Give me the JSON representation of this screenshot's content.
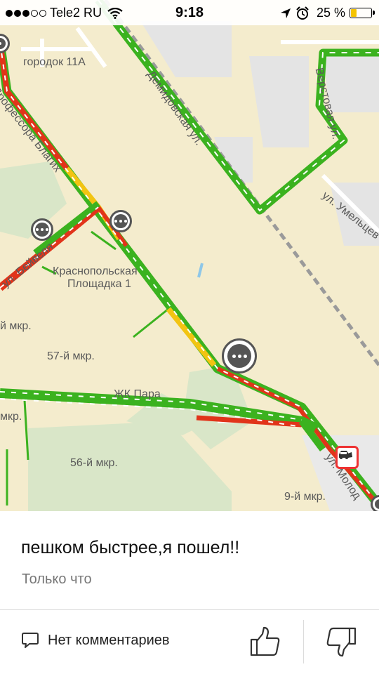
{
  "status_bar": {
    "carrier": "Tele2 RU",
    "time": "9:18",
    "battery_percent": "25 %",
    "battery_level": 0.25,
    "icons": [
      "signal-icon",
      "wifi-icon",
      "location-arrow-icon",
      "alarm-icon",
      "battery-icon"
    ]
  },
  "map": {
    "labels": {
      "gorodok": "городок 11А",
      "prof_blaгikh": "Профессора Благих",
      "demidovskaya": "Демидовская ул.",
      "verstovaya": "Верстовая ул.",
      "umeltsev": "ул. Умельцев",
      "beyvelya": "ул. Бейвеля",
      "krasnopolskaya_1": "Краснопольская",
      "krasnopolskaya_2": "Площадка 1",
      "mkr_57": "57-й мкр.",
      "zhk_para": "ЖК Пара",
      "mkr_56": "56-й мкр.",
      "mkr_9": "9-й мкр.",
      "mkr_left_1": "й мкр.",
      "mkr_left_2": "мкр.",
      "molod": "ул. Молод"
    },
    "colors": {
      "background": "#f4eccd",
      "park": "#d9e6c8",
      "block": "#e6e6e6",
      "traffic_green": "#3bb21f",
      "traffic_red": "#e1341a",
      "traffic_yellow": "#f2c412"
    }
  },
  "post": {
    "text": "пешком быстрее,я пошел!!",
    "time": "Только что"
  },
  "footer": {
    "comments_label": "Нет комментариев",
    "icons": [
      "comment-icon",
      "thumbs-up-icon",
      "thumbs-down-icon"
    ]
  }
}
